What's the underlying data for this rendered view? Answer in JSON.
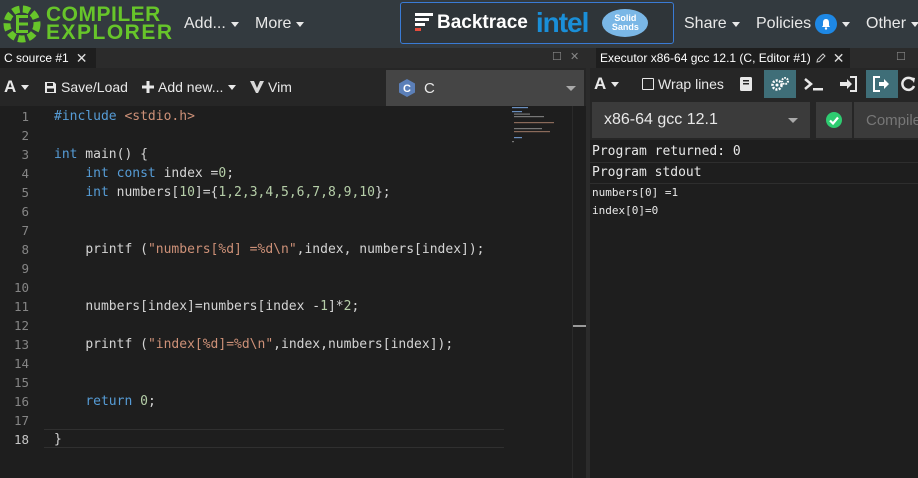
{
  "navbar": {
    "logo_line1": "COMPILER",
    "logo_line2": "EXPLORER",
    "add_label": "Add...",
    "more_label": "More",
    "sponsor_backtrace": "Backtrace",
    "sponsor_intel": "intel",
    "sponsor_solid_1": "Solid",
    "sponsor_solid_2": "Sands",
    "share_label": "Share",
    "policies_label": "Policies",
    "other_label": "Other"
  },
  "source_pane": {
    "tab_title": "C source #1",
    "toolbar": {
      "font_label": "A",
      "save_label": "Save/Load",
      "add_new_label": "Add new...",
      "vim_label": "Vim"
    },
    "language": "C",
    "active_line": 18,
    "line_numbers": [
      "1",
      "2",
      "3",
      "4",
      "5",
      "6",
      "7",
      "8",
      "9",
      "10",
      "11",
      "12",
      "13",
      "14",
      "15",
      "16",
      "17",
      "18"
    ],
    "code_lines": [
      "#include <stdio.h>",
      "",
      "int main() {",
      "    int const index =0;",
      "    int numbers[10]={1,2,3,4,5,6,7,8,9,10};",
      "",
      "",
      "    printf (\"numbers[%d] =%d\\n\",index, numbers[index]);",
      "",
      "",
      "    numbers[index]=numbers[index -1]*2;",
      "",
      "    printf (\"index[%d]=%d\\n\",index,numbers[index]);",
      "",
      "",
      "    return 0;",
      "",
      "}"
    ],
    "tokens": {
      "l1_pp": "#include ",
      "l1_hdr": "<stdio.h>",
      "l3_kw": "int",
      "l3_rest": " main() {",
      "l4_kw1": "int",
      "l4_kw2": "const",
      "l4_mid": " index =",
      "l4_num": "0",
      "l4_end": ";",
      "l5_kw": "int",
      "l5_a": " numbers[",
      "l5_n10": "10",
      "l5_b": "]={",
      "l5_nums": "1,2,3,4,5,6,7,8,9,10",
      "l5_c": "};",
      "l8_a": "printf (",
      "l8_str": "\"numbers[%d] =%d\\n\"",
      "l8_b": ",index, numbers[index]);",
      "l11_a": "numbers[index]=numbers[index -",
      "l11_n1": "1",
      "l11_b": "]*",
      "l11_n2": "2",
      "l11_c": ";",
      "l13_a": "printf (",
      "l13_str": "\"index[%d]=%d\\n\"",
      "l13_b": ",index,numbers[index]);",
      "l16_kw": "return",
      "l16_num": "0",
      "l16_end": ";",
      "l18": "}"
    }
  },
  "executor_pane": {
    "tab_title": "Executor x86-64 gcc 12.1 (C, Editor #1)",
    "toolbar": {
      "font_label": "A",
      "wrap_label": "Wrap lines"
    },
    "compiler": "x86-64 gcc 12.1",
    "compile_label": "Compiler options...",
    "program_returned": "Program returned: 0",
    "stdout_header": "Program stdout",
    "stdout_lines": [
      "numbers[0] =1",
      "index[0]=0"
    ]
  },
  "colors": {
    "brand_green": "#67c52a",
    "navbar_bg": "#333a3f",
    "editor_bg": "#1e1e1e",
    "keyword": "#569cd6",
    "string": "#ce9178",
    "number": "#b5cea8",
    "accent_blue": "#1e88e5",
    "success_green": "#2ecc71"
  }
}
